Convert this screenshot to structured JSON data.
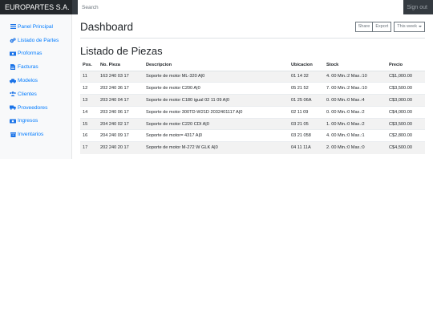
{
  "topbar": {
    "brand": "EUROPARTES S.A.",
    "search_placeholder": "Search",
    "signout": "Sign out"
  },
  "sidebar": {
    "items": [
      {
        "label": "Panel Principal",
        "icon": "list-icon"
      },
      {
        "label": "Listado de Partes",
        "icon": "cogs-icon"
      },
      {
        "label": "Proformas",
        "icon": "money-icon"
      },
      {
        "label": "Facturas",
        "icon": "file-invoice-icon"
      },
      {
        "label": "Modelos",
        "icon": "car-icon"
      },
      {
        "label": "Clientes",
        "icon": "users-icon"
      },
      {
        "label": "Proveedores",
        "icon": "truck-icon"
      },
      {
        "label": "Ingresos",
        "icon": "cash-icon"
      },
      {
        "label": "Inventarios",
        "icon": "archive-icon"
      }
    ]
  },
  "main": {
    "title": "Dashboard",
    "share_label": "Share",
    "export_label": "Export",
    "period_label": "This week",
    "section_title": "Listado de Piezas",
    "columns": [
      "Pos.",
      "No. Pieza",
      "Descripcion",
      "Ubicacion",
      "Stock",
      "Precio"
    ],
    "rows": [
      [
        "11",
        "163 240 03 17",
        "Soporte de motor ML-320 A|0",
        "01 14 32",
        "4. 00 Min.:2 Max.:10",
        "C$1,000.00"
      ],
      [
        "12",
        "202 240 36 17",
        "Soporte de motor C200 A|0",
        "05 21 52",
        "7. 00 Min.:2 Max.:10",
        "C$3,500.00"
      ],
      [
        "13",
        "203 240 04 17",
        "Soporte de motor C180 igual 02 11 09 A|0",
        "01 25 06A",
        "0. 00 Min.:0 Max.:4",
        "C$3,000.00"
      ],
      [
        "14",
        "203 240 06 17",
        "Soporte de motor 300TD-W21D 2032401117 A|0",
        "02 11 09",
        "0. 00 Min.:0 Max.:2",
        "C$4,000.00"
      ],
      [
        "15",
        "204 240 02 17",
        "Soporte de motor C220 CDI A|0",
        "03 21 05",
        "1. 00 Min.:0 Max.:2",
        "C$3,500.00"
      ],
      [
        "16",
        "204 240 09 17",
        "Soporte de motor= 4317 A|0",
        "03 21 058",
        "4. 00 Min.:0 Max.:1",
        "C$2,800.00"
      ],
      [
        "17",
        "202 240 20 17",
        "Soporte de motor M-272 W GLK A|0",
        "04 11 11A",
        "2. 00 Min.:0 Max.:0",
        "C$4,500.00"
      ]
    ]
  }
}
